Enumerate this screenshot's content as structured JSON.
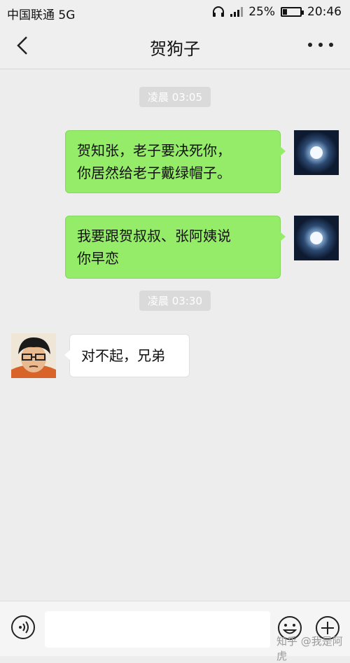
{
  "status_bar": {
    "carrier": "中国联通 5G",
    "battery": "25%",
    "battery_level": 0.25,
    "time": "20:46"
  },
  "header": {
    "title": "贺狗子"
  },
  "messages": [
    {
      "type": "time",
      "text": "凌晨 03:05"
    },
    {
      "type": "sent",
      "text_lines": [
        "贺知张，老子要决死你，",
        "你居然给老子戴绿帽子。"
      ]
    },
    {
      "type": "sent",
      "text_lines": [
        "我要跟贺叔叔、张阿姨说",
        "你早恋"
      ]
    },
    {
      "type": "time",
      "text": "凌晨 03:30"
    },
    {
      "type": "received",
      "text_lines": [
        "对不起，兄弟"
      ]
    }
  ],
  "input_bar": {
    "placeholder": ""
  },
  "watermark": "知乎 @我是阿虎",
  "colors": {
    "sent_bubble": "#95ec69",
    "received_bubble": "#ffffff",
    "background": "#ededed"
  },
  "icons": [
    "back-arrow-icon",
    "more-dots-icon",
    "headphones-icon",
    "signal-icon",
    "battery-icon",
    "voice-icon",
    "emoji-icon",
    "plus-icon"
  ]
}
